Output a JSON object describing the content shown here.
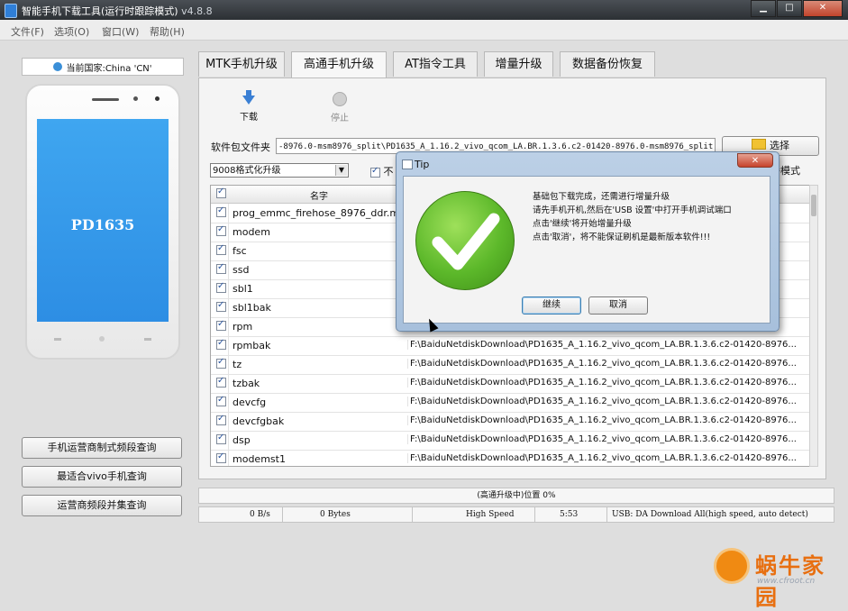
{
  "window": {
    "title": "智能手机下载工具(运行时跟踪模式)",
    "version": "v4.8.8",
    "btn_min": "▁",
    "btn_max": "□",
    "btn_close": "✕"
  },
  "menu": [
    "文件(F)",
    "选项(O)",
    "窗口(W)",
    "帮助(H)"
  ],
  "country": "当前国家:China 'CN'",
  "phone_model": "PD1635",
  "side_buttons": [
    "手机运营商制式频段查询",
    "最适合vivo手机查询",
    "运营商频段并集查询"
  ],
  "tabs": [
    "MTK手机升级",
    "高通手机升级",
    "AT指令工具",
    "增量升级",
    "数据备份恢复"
  ],
  "tools": {
    "download": "下载",
    "stop": "停止"
  },
  "package": {
    "label": "软件包文件夹",
    "value": "-8976.0-msm8976_split\\PD1635_A_1.16.2_vivo_qcom_LA.BR.1.3.6.c2-01420-8976.0-msm8976_split",
    "choose": "选择"
  },
  "mode": {
    "value": "9008格式化升级",
    "arrow": "▼",
    "checkbox_label": "不",
    "right_label": "播模式"
  },
  "grid": {
    "header_name": "名字",
    "rows": [
      {
        "name": "prog_emmc_firehose_8976_ddr.mb",
        "path": "8976..."
      },
      {
        "name": "modem",
        "path": "8976..."
      },
      {
        "name": "fsc",
        "path": ""
      },
      {
        "name": "ssd",
        "path": ""
      },
      {
        "name": "sbl1",
        "path": "8976..."
      },
      {
        "name": "sbl1bak",
        "path": "8976..."
      },
      {
        "name": "rpm",
        "path": "8976..."
      },
      {
        "name": "rpmbak",
        "path": "F:\\BaiduNetdiskDownload\\PD1635_A_1.16.2_vivo_qcom_LA.BR.1.3.6.c2-01420-8976..."
      },
      {
        "name": "tz",
        "path": "F:\\BaiduNetdiskDownload\\PD1635_A_1.16.2_vivo_qcom_LA.BR.1.3.6.c2-01420-8976..."
      },
      {
        "name": "tzbak",
        "path": "F:\\BaiduNetdiskDownload\\PD1635_A_1.16.2_vivo_qcom_LA.BR.1.3.6.c2-01420-8976..."
      },
      {
        "name": "devcfg",
        "path": "F:\\BaiduNetdiskDownload\\PD1635_A_1.16.2_vivo_qcom_LA.BR.1.3.6.c2-01420-8976..."
      },
      {
        "name": "devcfgbak",
        "path": "F:\\BaiduNetdiskDownload\\PD1635_A_1.16.2_vivo_qcom_LA.BR.1.3.6.c2-01420-8976..."
      },
      {
        "name": "dsp",
        "path": "F:\\BaiduNetdiskDownload\\PD1635_A_1.16.2_vivo_qcom_LA.BR.1.3.6.c2-01420-8976..."
      },
      {
        "name": "modemst1",
        "path": "F:\\BaiduNetdiskDownload\\PD1635_A_1.16.2_vivo_qcom_LA.BR.1.3.6.c2-01420-8976..."
      }
    ]
  },
  "status": {
    "progress_text": "(高通升级中)位置 0%",
    "speed": "0 B/s",
    "bytes": "0 Bytes",
    "mode": "High Speed",
    "time": "5:53",
    "usb": "USB: DA Download All(high speed, auto detect)"
  },
  "dialog": {
    "title": "Tip",
    "close": "✕",
    "lines": [
      "基础包下载完成，还需进行增量升级",
      "请先手机开机,然后在'USB 设置'中打开手机调试端口",
      "点击'继续'将开始增量升级",
      "点击'取消'，将不能保证刷机是最新版本软件!!!"
    ],
    "continue": "继续",
    "cancel": "取消"
  },
  "watermark": {
    "name": "蜗牛家园",
    "url": "www.cfroot.cn"
  },
  "colors": {
    "accent": "#3a7fd4",
    "success": "#5cb82a",
    "titlebar": "#2c3034"
  }
}
